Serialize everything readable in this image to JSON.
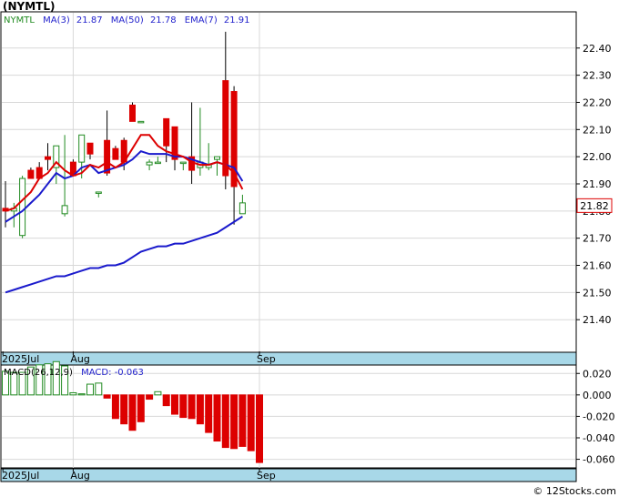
{
  "chart_data": [
    {
      "type": "candlestick",
      "title": "(NYMTL)",
      "legend": {
        "symbol": "NYMTL",
        "items": [
          {
            "label": "MA(3)",
            "value": "21.87",
            "color": "#2222cc"
          },
          {
            "label": "MA(50)",
            "value": "21.78",
            "color": "#2222cc"
          },
          {
            "label": "EMA(7)",
            "value": "21.91",
            "color": "#2222cc"
          }
        ]
      },
      "ylim": [
        21.28,
        22.53
      ],
      "yticks": [
        "22.40",
        "22.30",
        "22.20",
        "22.10",
        "22.00",
        "21.90",
        "21.80",
        "21.70",
        "21.60",
        "21.50",
        "21.40"
      ],
      "x_labels": [
        {
          "label": "2025Jul",
          "index": -0.3
        },
        {
          "label": "Aug",
          "index": 8
        },
        {
          "label": "Sep",
          "index": 30
        }
      ],
      "last_price": "21.82",
      "colors": {
        "up": "#228b22",
        "down": "#dd0000",
        "ma3": "#dd0000",
        "ma50": "#1a1acc",
        "ema7": "#1a1acc",
        "axis_band": "#a8d8e8",
        "grid": "#d8d8d8"
      },
      "candles": [
        {
          "o": 21.81,
          "h": 21.91,
          "l": 21.74,
          "c": 21.8
        },
        {
          "o": 21.8,
          "h": 21.83,
          "l": 21.74,
          "c": 21.81
        },
        {
          "o": 21.71,
          "h": 21.93,
          "l": 21.7,
          "c": 21.92
        },
        {
          "o": 21.95,
          "h": 21.96,
          "l": 21.92,
          "c": 21.92
        },
        {
          "o": 21.96,
          "h": 21.98,
          "l": 21.92,
          "c": 21.92
        },
        {
          "o": 22.0,
          "h": 22.05,
          "l": 21.95,
          "c": 21.99
        },
        {
          "o": 21.96,
          "h": 22.04,
          "l": 21.9,
          "c": 22.04
        },
        {
          "o": 21.79,
          "h": 22.08,
          "l": 21.78,
          "c": 21.82
        },
        {
          "o": 21.98,
          "h": 21.99,
          "l": 21.93,
          "c": 21.93
        },
        {
          "o": 21.98,
          "h": 22.08,
          "l": 21.92,
          "c": 22.08
        },
        {
          "o": 22.05,
          "h": 22.05,
          "l": 21.99,
          "c": 22.01
        },
        {
          "o": 21.87,
          "h": 21.87,
          "l": 21.85,
          "c": 21.87
        },
        {
          "o": 22.06,
          "h": 22.17,
          "l": 21.93,
          "c": 21.94
        },
        {
          "o": 22.03,
          "h": 22.04,
          "l": 21.99,
          "c": 21.99
        },
        {
          "o": 22.06,
          "h": 22.07,
          "l": 21.95,
          "c": 21.98
        },
        {
          "o": 22.19,
          "h": 22.2,
          "l": 22.13,
          "c": 22.13
        },
        {
          "o": 22.13,
          "h": 22.13,
          "l": 22.13,
          "c": 22.13
        },
        {
          "o": 21.97,
          "h": 21.99,
          "l": 21.95,
          "c": 21.98
        },
        {
          "o": 21.98,
          "h": 22.0,
          "l": 21.98,
          "c": 21.98
        },
        {
          "o": 22.14,
          "h": 22.14,
          "l": 21.98,
          "c": 22.04
        },
        {
          "o": 22.11,
          "h": 22.11,
          "l": 21.95,
          "c": 21.99
        },
        {
          "o": 21.98,
          "h": 21.98,
          "l": 21.95,
          "c": 21.98
        },
        {
          "o": 22.0,
          "h": 22.2,
          "l": 21.9,
          "c": 21.95
        },
        {
          "o": 21.96,
          "h": 22.18,
          "l": 21.93,
          "c": 21.98
        },
        {
          "o": 21.96,
          "h": 22.05,
          "l": 21.95,
          "c": 21.97
        },
        {
          "o": 21.99,
          "h": 22.0,
          "l": 21.93,
          "c": 22.0
        },
        {
          "o": 22.28,
          "h": 22.46,
          "l": 21.88,
          "c": 21.93
        },
        {
          "o": 22.24,
          "h": 22.26,
          "l": 21.75,
          "c": 21.89
        },
        {
          "o": 21.79,
          "h": 21.86,
          "l": 21.79,
          "c": 21.83
        }
      ],
      "ma3": [
        21.8,
        21.81,
        21.84,
        21.87,
        21.92,
        21.94,
        21.98,
        21.95,
        21.93,
        21.94,
        21.97,
        21.96,
        21.98,
        21.96,
        21.98,
        22.03,
        22.08,
        22.08,
        22.04,
        22.02,
        22.01,
        22.0,
        21.98,
        21.97,
        21.97,
        21.98,
        21.97,
        21.94,
        21.88
      ],
      "ema7": [
        21.76,
        21.78,
        21.8,
        21.83,
        21.86,
        21.9,
        21.94,
        21.92,
        21.93,
        21.96,
        21.97,
        21.94,
        21.95,
        21.96,
        21.97,
        21.99,
        22.02,
        22.01,
        22.01,
        22.01,
        22.0,
        22.0,
        21.99,
        21.98,
        21.97,
        21.98,
        21.97,
        21.96,
        21.91
      ],
      "ma50": [
        21.5,
        21.51,
        21.52,
        21.53,
        21.54,
        21.55,
        21.56,
        21.56,
        21.57,
        21.58,
        21.59,
        21.59,
        21.6,
        21.6,
        21.61,
        21.63,
        21.65,
        21.66,
        21.67,
        21.67,
        21.68,
        21.68,
        21.69,
        21.7,
        21.71,
        21.72,
        21.74,
        21.76,
        21.78
      ]
    },
    {
      "type": "bar",
      "title": "MACD(26,12,9)",
      "macd_label": "MACD:",
      "macd_value": "-0.063",
      "ylim": [
        -0.068,
        0.027
      ],
      "yticks": [
        "0.020",
        "0.000",
        "-0.020",
        "-0.040",
        "-0.060"
      ],
      "x_labels": [
        {
          "label": "2025Jul",
          "index": -0.3
        },
        {
          "label": "Aug",
          "index": 8
        },
        {
          "label": "Sep",
          "index": 30
        }
      ],
      "values": [
        0.022,
        0.021,
        0.021,
        0.026,
        0.028,
        0.029,
        0.031,
        0.027,
        0.002,
        0.001,
        0.01,
        0.011,
        -0.003,
        -0.022,
        -0.027,
        -0.033,
        -0.025,
        -0.004,
        0.003,
        -0.01,
        -0.018,
        -0.021,
        -0.022,
        -0.027,
        -0.035,
        -0.043,
        -0.049,
        -0.05,
        -0.048,
        -0.052,
        -0.063
      ]
    }
  ],
  "watermark": "© 12Stocks.com"
}
